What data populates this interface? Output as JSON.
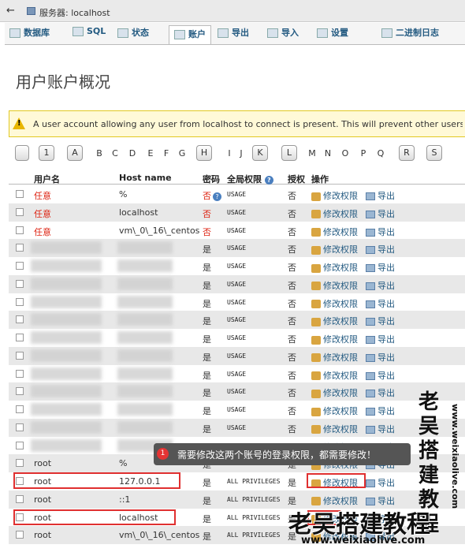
{
  "window": {
    "title": "服务器: localhost"
  },
  "tabs": [
    {
      "label": "数据库",
      "active": false
    },
    {
      "label": "SQL",
      "active": false
    },
    {
      "label": "状态",
      "active": false
    },
    {
      "label": "账户",
      "active": true
    },
    {
      "label": "导出",
      "active": false
    },
    {
      "label": "导入",
      "active": false
    },
    {
      "label": "设置",
      "active": false
    },
    {
      "label": "二进制日志",
      "active": false
    }
  ],
  "page_title": "用户账户概况",
  "notice": {
    "text": "A user account allowing any user from localhost to connect is present. This will prevent other users fr"
  },
  "alphabet": [
    {
      "label": "",
      "button": true
    },
    {
      "label": "1",
      "button": true
    },
    {
      "label": "A",
      "button": true
    },
    {
      "label": "B",
      "button": false
    },
    {
      "label": "C",
      "button": false
    },
    {
      "label": "D",
      "button": false
    },
    {
      "label": "E",
      "button": false
    },
    {
      "label": "F",
      "button": false
    },
    {
      "label": "G",
      "button": false
    },
    {
      "label": "H",
      "button": true
    },
    {
      "label": "I",
      "button": false
    },
    {
      "label": "J",
      "button": false
    },
    {
      "label": "K",
      "button": true
    },
    {
      "label": "L",
      "button": true
    },
    {
      "label": "M",
      "button": false
    },
    {
      "label": "N",
      "button": false
    },
    {
      "label": "O",
      "button": false
    },
    {
      "label": "P",
      "button": false
    },
    {
      "label": "Q",
      "button": false
    },
    {
      "label": "R",
      "button": true
    },
    {
      "label": "S",
      "button": true
    }
  ],
  "columns": {
    "user": "用户名",
    "host": "Host name",
    "password": "密码",
    "privileges": "全局权限",
    "grant": "授权",
    "action": "操作"
  },
  "action_labels": {
    "edit": "修改权限",
    "export": "导出"
  },
  "rows": [
    {
      "user": "任意",
      "host": "%",
      "password": "否",
      "privileges": "USAGE",
      "grant": "否",
      "user_red": true,
      "pw_red": true,
      "pw_help": true,
      "blurred": false
    },
    {
      "user": "任意",
      "host": "localhost",
      "password": "否",
      "privileges": "USAGE",
      "grant": "否",
      "user_red": true,
      "pw_red": true,
      "pw_help": false,
      "blurred": false
    },
    {
      "user": "任意",
      "host": "vm\\_0\\_16\\_centos",
      "password": "否",
      "privileges": "USAGE",
      "grant": "否",
      "user_red": true,
      "pw_red": true,
      "pw_help": false,
      "blurred": false
    },
    {
      "user": "",
      "host": "",
      "password": "是",
      "privileges": "USAGE",
      "grant": "否",
      "user_red": false,
      "pw_red": false,
      "pw_help": false,
      "blurred": true
    },
    {
      "user": "",
      "host": "",
      "password": "是",
      "privileges": "USAGE",
      "grant": "否",
      "user_red": false,
      "pw_red": false,
      "pw_help": false,
      "blurred": true
    },
    {
      "user": "",
      "host": "",
      "password": "是",
      "privileges": "USAGE",
      "grant": "否",
      "user_red": false,
      "pw_red": false,
      "pw_help": false,
      "blurred": true
    },
    {
      "user": "",
      "host": "",
      "password": "是",
      "privileges": "USAGE",
      "grant": "否",
      "user_red": false,
      "pw_red": false,
      "pw_help": false,
      "blurred": true
    },
    {
      "user": "",
      "host": "",
      "password": "是",
      "privileges": "USAGE",
      "grant": "否",
      "user_red": false,
      "pw_red": false,
      "pw_help": false,
      "blurred": true
    },
    {
      "user": "",
      "host": "",
      "password": "是",
      "privileges": "USAGE",
      "grant": "否",
      "user_red": false,
      "pw_red": false,
      "pw_help": false,
      "blurred": true
    },
    {
      "user": "",
      "host": "",
      "password": "是",
      "privileges": "USAGE",
      "grant": "否",
      "user_red": false,
      "pw_red": false,
      "pw_help": false,
      "blurred": true
    },
    {
      "user": "",
      "host": "",
      "password": "是",
      "privileges": "USAGE",
      "grant": "否",
      "user_red": false,
      "pw_red": false,
      "pw_help": false,
      "blurred": true
    },
    {
      "user": "",
      "host": "",
      "password": "是",
      "privileges": "USAGE",
      "grant": "否",
      "user_red": false,
      "pw_red": false,
      "pw_help": false,
      "blurred": true
    },
    {
      "user": "",
      "host": "",
      "password": "是",
      "privileges": "USAGE",
      "grant": "否",
      "user_red": false,
      "pw_red": false,
      "pw_help": false,
      "blurred": true
    },
    {
      "user": "",
      "host": "",
      "password": "是",
      "privileges": "USAGE",
      "grant": "否",
      "user_red": false,
      "pw_red": false,
      "pw_help": false,
      "blurred": true
    },
    {
      "user": "",
      "host": "",
      "password": "是",
      "privileges": "USAGE",
      "grant": "否",
      "user_red": false,
      "pw_red": false,
      "pw_help": false,
      "blurred": true
    },
    {
      "user": "root",
      "host": "%",
      "password": "是",
      "privileges": "ALL PRIVILEGES",
      "grant": "是",
      "user_red": false,
      "pw_red": false,
      "pw_help": false,
      "blurred": false
    },
    {
      "user": "root",
      "host": "127.0.0.1",
      "password": "是",
      "privileges": "ALL PRIVILEGES",
      "grant": "是",
      "user_red": false,
      "pw_red": false,
      "pw_help": false,
      "blurred": false
    },
    {
      "user": "root",
      "host": "::1",
      "password": "是",
      "privileges": "ALL PRIVILEGES",
      "grant": "是",
      "user_red": false,
      "pw_red": false,
      "pw_help": false,
      "blurred": false
    },
    {
      "user": "root",
      "host": "localhost",
      "password": "是",
      "privileges": "ALL PRIVILEGES",
      "grant": "是",
      "user_red": false,
      "pw_red": false,
      "pw_help": false,
      "blurred": false
    },
    {
      "user": "root",
      "host": "vm\\_0\\_16\\_centos",
      "password": "是",
      "privileges": "ALL PRIVILEGES",
      "grant": "是",
      "user_red": false,
      "pw_red": false,
      "pw_help": false,
      "blurred": false
    }
  ],
  "tooltip": {
    "number": "1",
    "text": "需要修改这两个账号的登录权限，都需要修改！"
  },
  "watermark": {
    "side_title": [
      "老",
      "吴",
      "搭",
      "建",
      "教",
      "程"
    ],
    "side_url": "www.weixiaolive.com",
    "bottom_title": "老吴搭建教程",
    "bottom_url": "www.weixiaolive.com"
  },
  "colors": {
    "accent_link": "#235a81",
    "warning_bg": "#fff9d7",
    "danger": "#d21",
    "highlight_box": "#e03030"
  }
}
